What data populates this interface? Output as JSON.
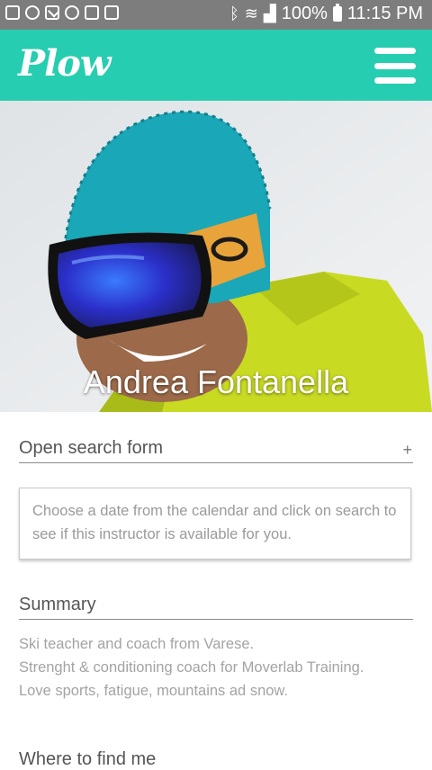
{
  "status_bar": {
    "battery": "100%",
    "time": "11:15 PM",
    "icons_left": [
      "image-icon",
      "whatsapp-icon",
      "gmail-icon",
      "sync-icon",
      "screenshot-icon",
      "briefcase-icon"
    ],
    "icons_right": [
      "bluetooth-icon",
      "wifi-icon",
      "signal-icon",
      "battery-icon"
    ]
  },
  "app": {
    "logo": "Plow",
    "brand_color": "#27cdb0",
    "menu_icon": "hamburger-menu-icon"
  },
  "profile": {
    "name": "Andrea Fontanella"
  },
  "search": {
    "toggle_label": "Open search form",
    "toggle_icon": "+",
    "hint": "Choose a date from the calendar and click on search to see if this instructor is available for you."
  },
  "summary": {
    "title": "Summary",
    "lines": [
      "Ski teacher and coach from Varese.",
      "Strenght & conditioning coach for Moverlab Training.",
      "Love sports, fatigue, mountains ad snow."
    ]
  },
  "where": {
    "title": "Where to find me"
  }
}
